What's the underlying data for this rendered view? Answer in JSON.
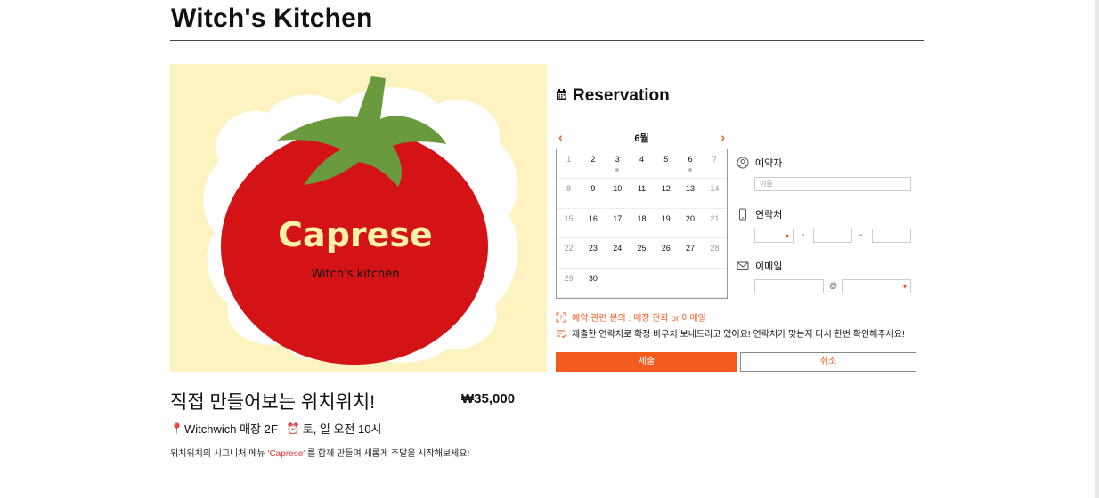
{
  "page": {
    "title": "Witch's Kitchen"
  },
  "hero": {
    "caption": "Caprese",
    "subcaption": "Witch's kitchen"
  },
  "product": {
    "name": "직접 만들어보는 위치위치!",
    "price": "₩35,000",
    "location": "Witchwich 매장 2F",
    "schedule": "토, 일 오전 10시",
    "description_pre": "위치위치의 시그니처 메뉴 ",
    "description_highlight": "'Caprese'",
    "description_post": " 를 함께 만들며 새롭게 주말을 시작해보세요!"
  },
  "reservation": {
    "heading": "Reservation",
    "calendar": {
      "month": "6월",
      "prev_glyph": "‹",
      "next_glyph": "›",
      "weeks": [
        [
          {
            "d": "1",
            "we": true
          },
          {
            "d": "2"
          },
          {
            "d": "3",
            "dot": true
          },
          {
            "d": "4"
          },
          {
            "d": "5"
          },
          {
            "d": "6",
            "dot": true
          },
          {
            "d": "7",
            "we": true
          }
        ],
        [
          {
            "d": "8",
            "we": true
          },
          {
            "d": "9"
          },
          {
            "d": "10"
          },
          {
            "d": "11"
          },
          {
            "d": "12"
          },
          {
            "d": "13"
          },
          {
            "d": "14",
            "we": true
          }
        ],
        [
          {
            "d": "15",
            "we": true
          },
          {
            "d": "16"
          },
          {
            "d": "17"
          },
          {
            "d": "18"
          },
          {
            "d": "19"
          },
          {
            "d": "20"
          },
          {
            "d": "21",
            "we": true
          }
        ],
        [
          {
            "d": "22",
            "we": true
          },
          {
            "d": "23"
          },
          {
            "d": "24"
          },
          {
            "d": "25"
          },
          {
            "d": "26"
          },
          {
            "d": "27"
          },
          {
            "d": "28",
            "we": true
          }
        ],
        [
          {
            "d": "29",
            "we": true
          },
          {
            "d": "30"
          },
          {
            "d": ""
          },
          {
            "d": ""
          },
          {
            "d": ""
          },
          {
            "d": ""
          },
          {
            "d": ""
          }
        ]
      ]
    },
    "form": {
      "name_label": "예약자",
      "name_placeholder": "이름",
      "phone_label": "연락처",
      "phone_sep": "-",
      "email_label": "이메일",
      "email_at": "@"
    },
    "notice_inquiry": "예약 관련 문의 : 매장 전화 or 이메일",
    "notice_voucher": "제출한 연락처로 확정 바우처 보내드리고 있어요! 연락처가 맞는지 다시 한번 확인해주세요!",
    "submit_label": "제출",
    "cancel_label": "취소"
  },
  "colors": {
    "accent": "#f35b1f",
    "tomato": "#d41317",
    "hero_bg": "#fdf3c0",
    "leaf": "#6a9a3e"
  }
}
